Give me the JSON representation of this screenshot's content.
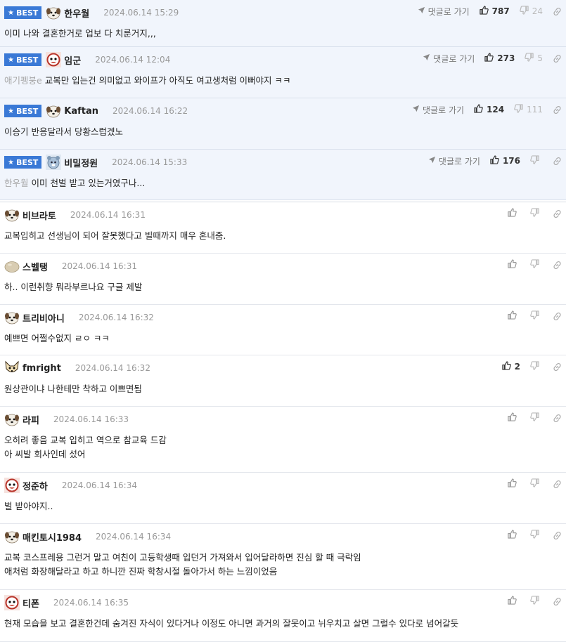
{
  "ui": {
    "best_label": "BEST",
    "reply_label": "댓글로 가기"
  },
  "comments": [
    {
      "best": true,
      "nick": "한우월",
      "date": "2024.06.14 15:29",
      "likes": "787",
      "dislikes": "24",
      "mention": "",
      "lines": [
        "이미 나와 결혼한거로 업보 다 치룬거지,,,"
      ],
      "avatar": "puppy",
      "h": 67
    },
    {
      "best": true,
      "nick": "임군",
      "date": "2024.06.14 12:04",
      "likes": "273",
      "dislikes": "5",
      "mention": "애기펭붕e",
      "lines": [
        "교복만 입는건 의미없고 와이프가 아직도 여고생처럼 이뻐야지 ㅋㅋ"
      ],
      "avatar": "cartoon",
      "h": 73
    },
    {
      "best": true,
      "nick": "Kaftan",
      "date": "2024.06.14 16:22",
      "likes": "124",
      "dislikes": "111",
      "mention": "",
      "lines": [
        "이승기 반응달라서 당황스럽겠노"
      ],
      "avatar": "puppy",
      "h": 73
    },
    {
      "best": true,
      "nick": "비밀정원",
      "date": "2024.06.14 15:33",
      "likes": "176",
      "dislikes": "",
      "mention": "한우월",
      "lines": [
        "이미 천벌 받고 있는거였구나..."
      ],
      "avatar": "bear",
      "h": 72
    },
    {
      "best": false,
      "nick": "비브라토",
      "date": "2024.06.14 16:31",
      "likes": "",
      "dislikes": "",
      "mention": "",
      "lines": [
        "교복입히고 선생님이 되어 잘못했다고 빌때까지 매우 혼내줌."
      ],
      "avatar": "puppy",
      "h": 73
    },
    {
      "best": false,
      "nick": "스벨탱",
      "date": "2024.06.14 16:31",
      "likes": "",
      "dislikes": "",
      "mention": "",
      "lines": [
        "하.. 이런취향 뭐라부르나요 구글 제발"
      ],
      "avatar": "blob",
      "h": 73
    },
    {
      "best": false,
      "nick": "트리비아니",
      "date": "2024.06.14 16:32",
      "likes": "",
      "dislikes": "",
      "mention": "",
      "lines": [
        "예쁘면 어쩔수없지 ㄹㅇ ㅋㅋ"
      ],
      "avatar": "puppy",
      "h": 72
    },
    {
      "best": false,
      "nick": "fmright",
      "date": "2024.06.14 16:32",
      "likes": "2",
      "dislikes": "",
      "mention": "",
      "lines": [
        "원상관이냐 나한테만 착하고 이쁘면됨"
      ],
      "avatar": "fox",
      "h": 73
    },
    {
      "best": false,
      "nick": "라피",
      "date": "2024.06.14 16:33",
      "likes": "",
      "dislikes": "",
      "mention": "",
      "lines": [
        "오히려 좋음 교복 입히고 역으로 참교육 드감",
        "아 씨발 회사인데 섰어"
      ],
      "avatar": "puppy",
      "h": 94
    },
    {
      "best": false,
      "nick": "정준하",
      "date": "2024.06.14 16:34",
      "likes": "",
      "dislikes": "",
      "mention": "",
      "lines": [
        "벌 받아야지.."
      ],
      "avatar": "cartoon",
      "h": 73
    },
    {
      "best": false,
      "nick": "매킨토시1984",
      "date": "2024.06.14 16:34",
      "likes": "",
      "dislikes": "",
      "mention": "",
      "lines": [
        "교복 코스프레용 그런거 말고 여친이 고등학생때 입던거 가져와서 입어달라하면 진심 할 때 극락임",
        "애처럼 화장해달라고 하고 하니깐 진짜 학창시절 돌아가서 하는 느낌이었음"
      ],
      "avatar": "puppy",
      "h": 94
    },
    {
      "best": false,
      "nick": "티폰",
      "date": "2024.06.14 16:35",
      "likes": "",
      "dislikes": "",
      "mention": "",
      "lines": [
        "현재 모습을 보고 결혼한건데 숨겨진 자식이 있다거나 이정도 아니면 과거의 잘못이고 뉘우치고 살면 그럴수 있다로 넘어갈듯"
      ],
      "avatar": "cartoon",
      "h": 74
    }
  ]
}
